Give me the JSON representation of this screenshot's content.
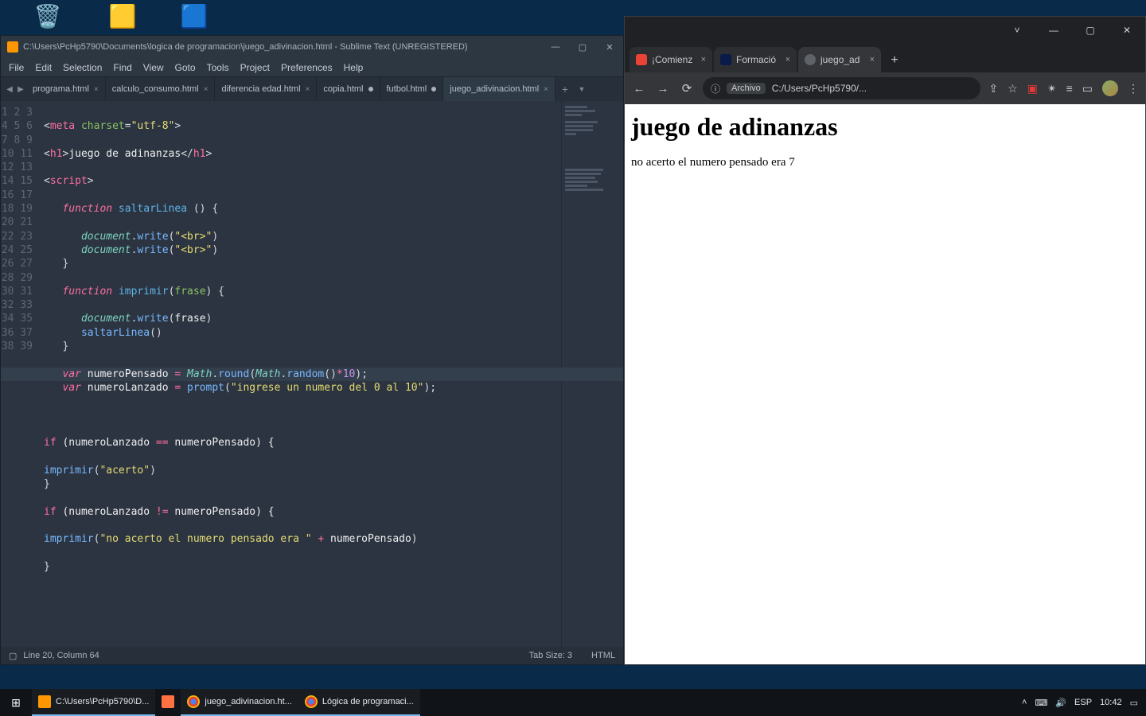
{
  "desktop": {
    "icons": [
      {
        "glyph": "🗑️",
        "label": ""
      },
      {
        "glyph": "🟨",
        "label": ""
      },
      {
        "glyph": "🟦",
        "label": ""
      }
    ]
  },
  "sublime": {
    "title": "C:\\Users\\PcHp5790\\Documents\\logica de programacion\\juego_adivinacion.html - Sublime Text (UNREGISTERED)",
    "menu": [
      "File",
      "Edit",
      "Selection",
      "Find",
      "View",
      "Goto",
      "Tools",
      "Project",
      "Preferences",
      "Help"
    ],
    "tabs": [
      {
        "label": "programa.html",
        "dirty": false,
        "active": false
      },
      {
        "label": "calculo_consumo.html",
        "dirty": false,
        "active": false
      },
      {
        "label": "diferencia edad.html",
        "dirty": false,
        "active": false
      },
      {
        "label": "copia.html",
        "dirty": true,
        "active": false
      },
      {
        "label": "futbol.html",
        "dirty": true,
        "active": false
      },
      {
        "label": "juego_adivinacion.html",
        "dirty": false,
        "active": true
      }
    ],
    "lines": 39,
    "highlight_line": 20,
    "status": {
      "left": "Line 20, Column 64",
      "tab": "Tab Size: 3",
      "lang": "HTML"
    },
    "code": {
      "l1": {
        "a": "<",
        "b": "meta",
        "c": " charset",
        "d": "=",
        "e": "\"utf-8\"",
        "f": ">"
      },
      "l3h1o": "<",
      "l3h1t": "h1",
      "l3h1c": ">",
      "l3txt": "juego de adinanzas",
      "l3h1co": "</",
      "l3h1ct": "h1",
      "l3h1ce": ">",
      "l5so": "<",
      "l5st": "script",
      "l5se": ">",
      "l7f": "function",
      "l7n": " saltarLinea ",
      "l7p": "() {",
      "l9o": "document",
      "l9d": ".",
      "l9m": "write",
      "l9a": "(",
      "l9s": "\"<br>\"",
      "l9c": ")",
      "l10o": "document",
      "l10d": ".",
      "l10m": "write",
      "l10a": "(",
      "l10s": "\"<br>\"",
      "l10c": ")",
      "l11": "}",
      "l13f": "function",
      "l13n": " imprimir",
      "l13p": "(",
      "l13arg": "frase",
      "l13pe": ") {",
      "l15o": "document",
      "l15d": ".",
      "l15m": "write",
      "l15a": "(",
      "l15arg": "frase",
      "l15c": ")",
      "l16n": "saltarLinea",
      "l16p": "()",
      "l17": "}",
      "l19v": "var",
      "l19id": " numeroPensado ",
      "l19eq": "= ",
      "l19m": "Math",
      "l19d": ".",
      "l19r": "round",
      "l19a": "(",
      "l19m2": "Math",
      "l19d2": ".",
      "l19r2": "random",
      "l19a2": "()",
      "l19mul": "*",
      "l19n": "10",
      "l19c": ");",
      "l20v": "var",
      "l20id": " numeroLanzado ",
      "l20eq": "= ",
      "l20p": "prompt",
      "l20a": "(",
      "l20s": "\"ingrese un numero del 0 al 10\"",
      "l20c": ");",
      "l24if": "if",
      "l24a": " (numeroLanzado ",
      "l24op": "==",
      "l24b": " numeroPensado) {",
      "l26n": "imprimir",
      "l26a": "(",
      "l26s": "\"acerto\"",
      "l26c": ")",
      "l27": "}",
      "l29if": "if",
      "l29a": " (numeroLanzado ",
      "l29op": "!=",
      "l29b": " numeroPensado) {",
      "l31n": "imprimir",
      "l31a": "(",
      "l31s": "\"no acerto el numero pensado era \"",
      "l31p": " + ",
      "l31id": "numeroPensado",
      "l31c": ")",
      "l33": "}"
    }
  },
  "chrome": {
    "tabs": [
      {
        "label": "¡Comienz",
        "fav": "#ea4335"
      },
      {
        "label": "Formació",
        "fav": "#0a1a4a"
      },
      {
        "label": "juego_ad",
        "fav": "#9aa0a6"
      }
    ],
    "active_tab": 2,
    "omnibox": {
      "info_icon": "ⓘ",
      "pill": "Archivo",
      "url": "C:/Users/PcHp5790/..."
    },
    "toolbar_icons": {
      "share": "⇪",
      "star": "☆",
      "ext": "▣",
      "puzzle": "✴",
      "list": "≡",
      "panel": "▭",
      "menu": "⋮"
    },
    "page": {
      "h1": "juego de adinanzas",
      "p": "no acerto el numero pensado era 7"
    }
  },
  "taskbar": {
    "start": "⊞",
    "items": [
      {
        "label": "C:\\Users\\PcHp5790\\D...",
        "color": "#ff9800"
      },
      {
        "label": "",
        "color": "#ff7043"
      },
      {
        "label": "juego_adivinacion.ht...",
        "color": "#1da462"
      },
      {
        "label": "Lógica de programaci...",
        "color": "#1da462"
      }
    ],
    "tray": {
      "up": "˄",
      "key": "⌨",
      "vol": "🔊",
      "lang": "ESP",
      "time": "10:42",
      "action": "▭"
    }
  }
}
